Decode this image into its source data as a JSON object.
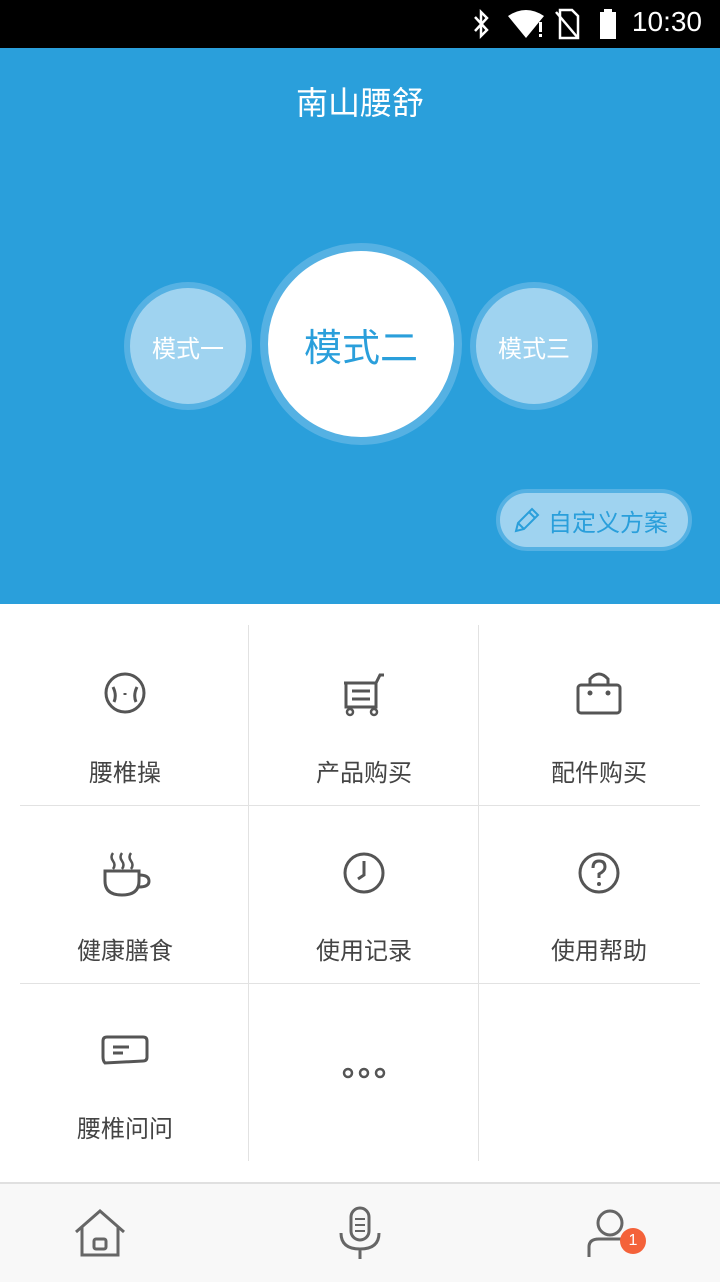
{
  "status_bar": {
    "time": "10:30",
    "icons": [
      "bluetooth-icon",
      "wifi-icon",
      "no-sim-icon",
      "battery-icon"
    ]
  },
  "app": {
    "title": "南山腰舒"
  },
  "modes": [
    {
      "label": "模式一",
      "selected": false
    },
    {
      "label": "模式二",
      "selected": true
    },
    {
      "label": "模式三",
      "selected": false
    }
  ],
  "custom_plan": {
    "label": "自定义方案",
    "icon": "pencil-icon"
  },
  "grid": [
    {
      "label": "腰椎操",
      "icon": "exercise-icon"
    },
    {
      "label": "产品购买",
      "icon": "cart-icon"
    },
    {
      "label": "配件购买",
      "icon": "shopping-bag-icon"
    },
    {
      "label": "健康膳食",
      "icon": "coffee-cup-icon"
    },
    {
      "label": "使用记录",
      "icon": "clock-icon"
    },
    {
      "label": "使用帮助",
      "icon": "help-icon"
    },
    {
      "label": "腰椎问问",
      "icon": "chat-icon"
    },
    {
      "label": "",
      "icon": "more-icon"
    }
  ],
  "tabbar": {
    "items": [
      "home-icon",
      "microphone-icon",
      "profile-icon"
    ],
    "badge": "1"
  },
  "colors": {
    "primary": "#2a9fdb",
    "mode_ring": "#55b1e3",
    "mode_fill": "#9fd3f0",
    "badge": "#f4623a"
  }
}
